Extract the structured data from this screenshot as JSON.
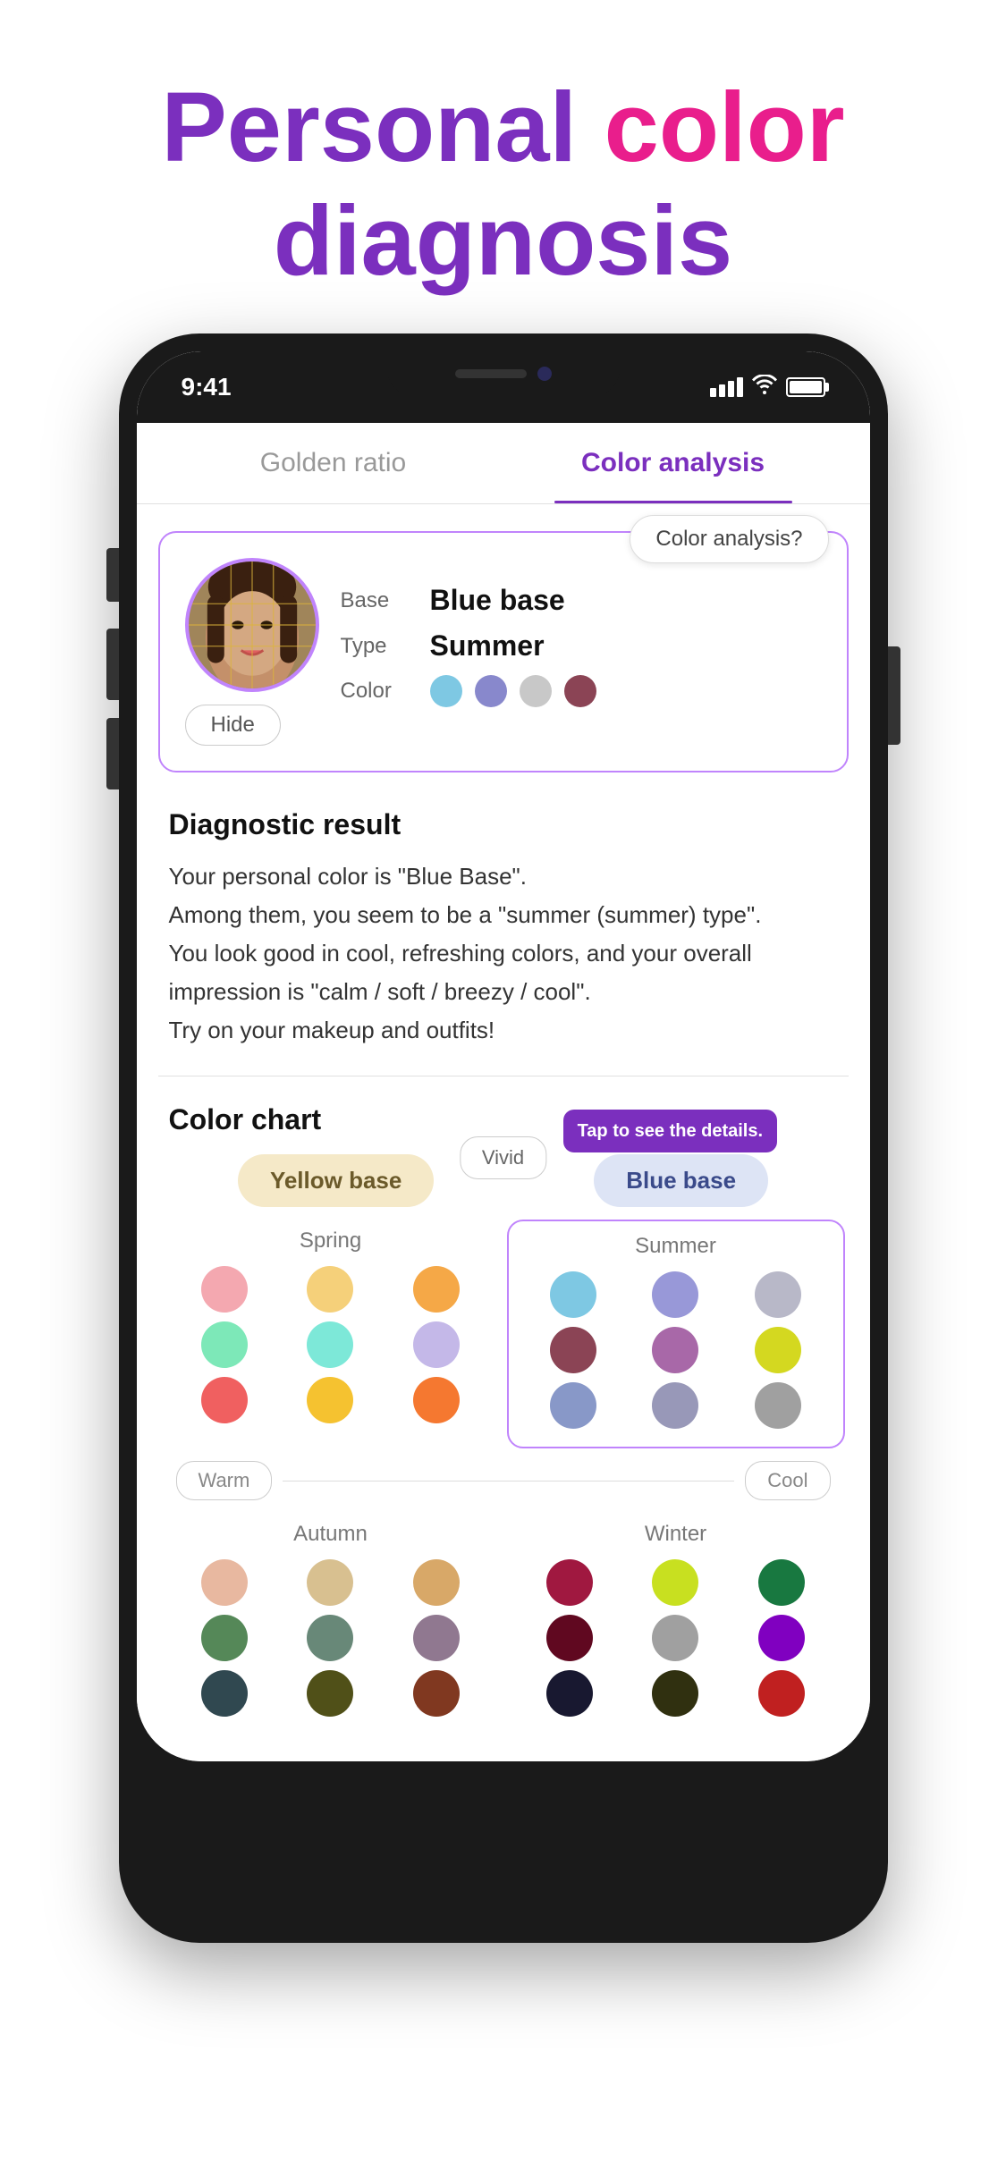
{
  "hero": {
    "personal": "Personal",
    "color": " color",
    "diagnosis": "diagnosis"
  },
  "status_bar": {
    "time": "9:41",
    "signal": "signal",
    "wifi": "wifi",
    "battery": "battery"
  },
  "tabs": [
    {
      "id": "golden-ratio",
      "label": "Golden ratio",
      "active": false
    },
    {
      "id": "color-analysis",
      "label": "Color analysis",
      "active": true
    }
  ],
  "result_card": {
    "base_label": "Base",
    "base_value": "Blue base",
    "type_label": "Type",
    "type_value": "Summer",
    "color_label": "Color",
    "hide_button": "Hide",
    "colors": [
      {
        "name": "light-blue",
        "hex": "#7ec8e3"
      },
      {
        "name": "periwinkle",
        "hex": "#8888cc"
      },
      {
        "name": "light-gray",
        "hex": "#c8c8c8"
      },
      {
        "name": "mauve",
        "hex": "#8b4455"
      }
    ]
  },
  "analysis_button": "Color analysis?",
  "diagnostic": {
    "title": "Diagnostic result",
    "text": "Your personal color is \"Blue Base\".\nAmong them, you seem to be a \"summer (summer) type\".\nYou look good in cool, refreshing colors, and your overall impression is \"calm / soft / breezy / cool\".\nTry on your makeup and outfits!"
  },
  "color_chart": {
    "title": "Color chart",
    "yellow_base_label": "Yellow base",
    "blue_base_label": "Blue base",
    "vivid_label": "Vivid",
    "warm_label": "Warm",
    "cool_label": "Cool",
    "tap_tooltip": "Tap to see the details.",
    "seasons": {
      "spring": {
        "name": "Spring",
        "dots": [
          "#f4a8b0",
          "#f5d07a",
          "#f5a847",
          "#7de8b8",
          "#7de8d8",
          "#c4b8e8",
          "#f06060",
          "#f5c230",
          "#f57830"
        ]
      },
      "summer": {
        "name": "Summer",
        "highlighted": true,
        "dots": [
          "#7ec8e3",
          "#9898d8",
          "#b8b8c8",
          "#8b4455",
          "#a868a8",
          "#d4d820",
          "#8898c8",
          "#9898b8",
          "#a0a0a0"
        ]
      },
      "autumn": {
        "name": "Autumn",
        "dots": [
          "#e8b8a0",
          "#d8c090",
          "#d8a868",
          "#558858",
          "#688878",
          "#907890",
          "#000000",
          "#000000",
          "#000000"
        ]
      },
      "winter": {
        "name": "Winter",
        "dots": [
          "#a01840",
          "#c8e020",
          "#187840",
          "#600820",
          "#a0a0a0",
          "#8000c0",
          "#181830",
          "#303010",
          "#c02020"
        ]
      }
    }
  }
}
